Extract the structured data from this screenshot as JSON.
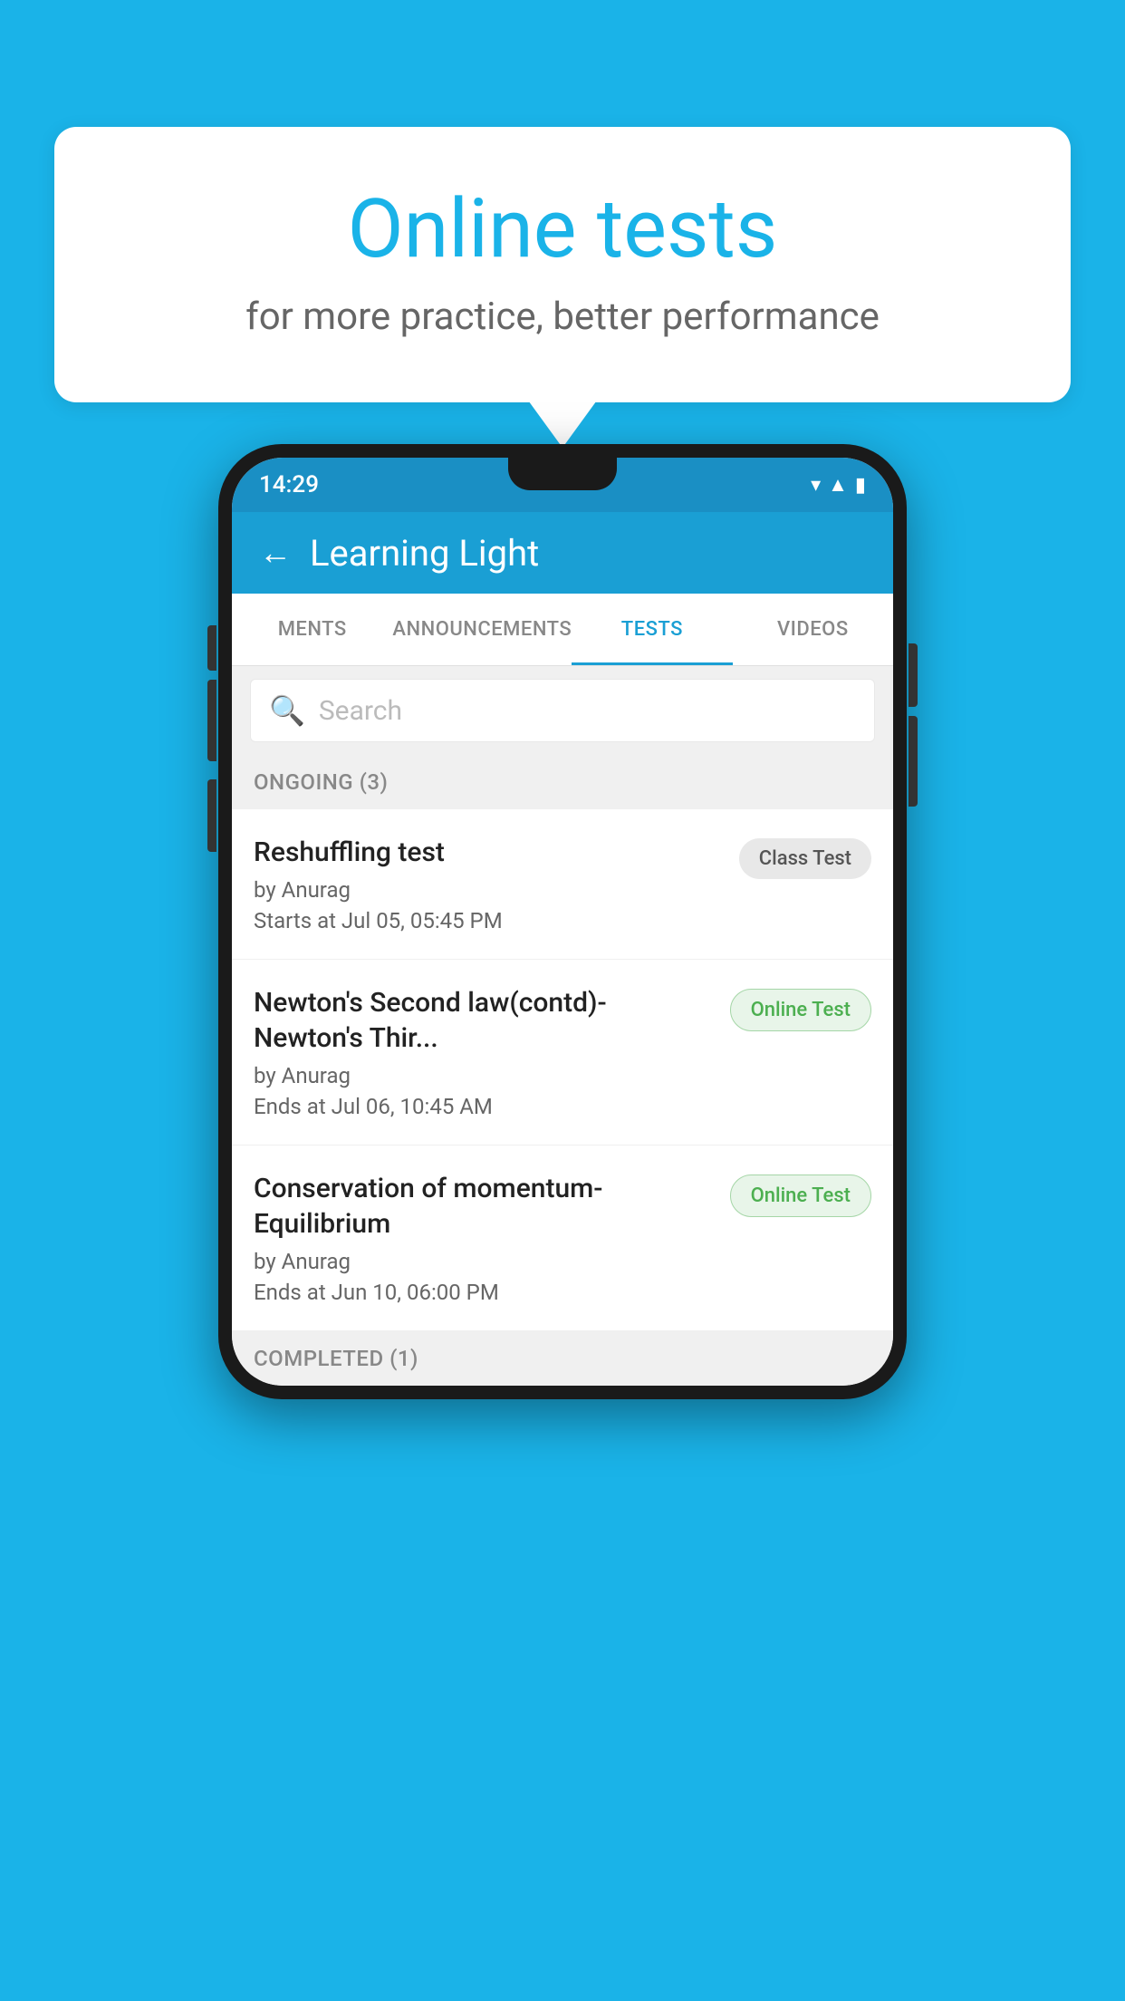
{
  "background_color": "#1ab3e8",
  "speech_bubble": {
    "title": "Online tests",
    "subtitle": "for more practice, better performance"
  },
  "phone": {
    "status_bar": {
      "time": "14:29",
      "icons": [
        "wifi",
        "signal",
        "battery"
      ]
    },
    "header": {
      "back_label": "←",
      "title": "Learning Light"
    },
    "tabs": [
      {
        "label": "MENTS",
        "active": false
      },
      {
        "label": "ANNOUNCEMENTS",
        "active": false
      },
      {
        "label": "TESTS",
        "active": true
      },
      {
        "label": "VIDEOS",
        "active": false
      }
    ],
    "search": {
      "placeholder": "Search",
      "icon": "🔍"
    },
    "sections": [
      {
        "title": "ONGOING (3)",
        "items": [
          {
            "name": "Reshuffling test",
            "author": "by Anurag",
            "date": "Starts at  Jul 05, 05:45 PM",
            "badge": "Class Test",
            "badge_type": "class"
          },
          {
            "name": "Newton's Second law(contd)-Newton's Thir...",
            "author": "by Anurag",
            "date": "Ends at  Jul 06, 10:45 AM",
            "badge": "Online Test",
            "badge_type": "online"
          },
          {
            "name": "Conservation of momentum-Equilibrium",
            "author": "by Anurag",
            "date": "Ends at  Jun 10, 06:00 PM",
            "badge": "Online Test",
            "badge_type": "online"
          }
        ]
      }
    ],
    "completed_section": {
      "title": "COMPLETED (1)"
    }
  }
}
